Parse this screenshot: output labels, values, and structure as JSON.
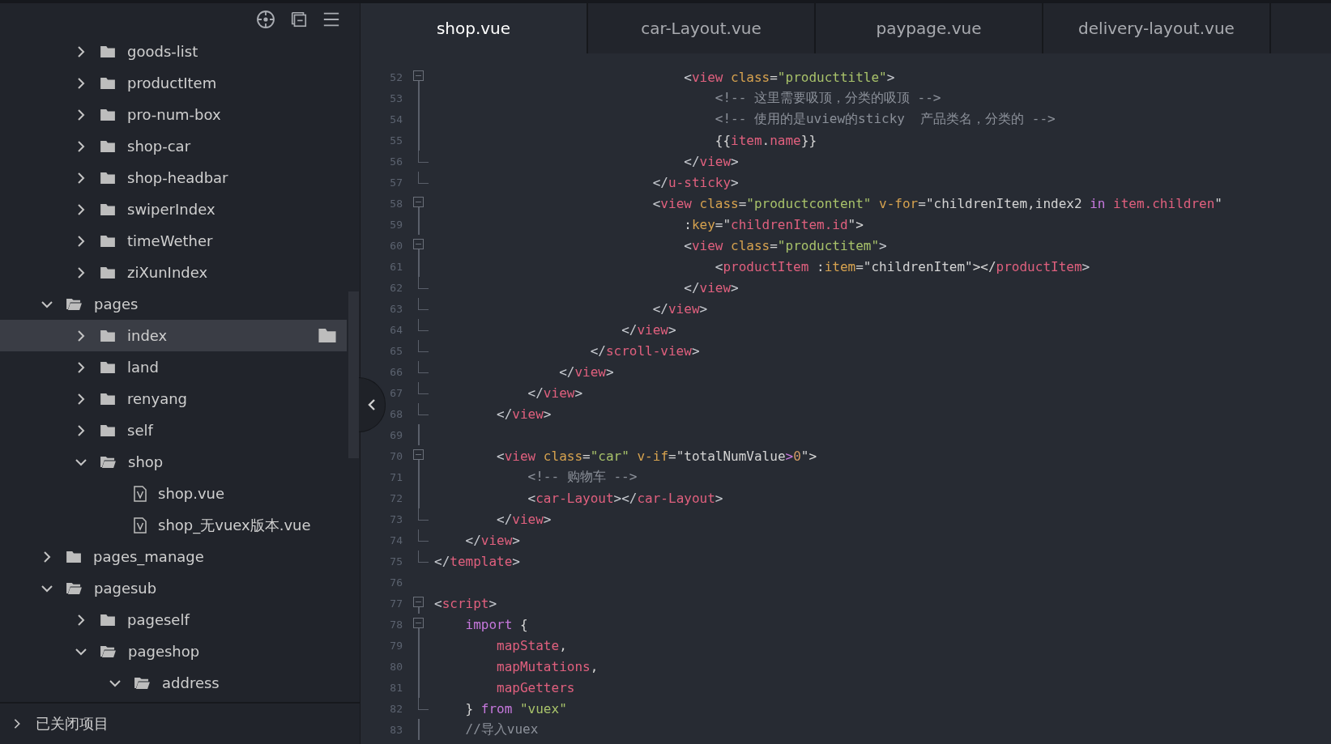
{
  "sidebar": {
    "tree": [
      {
        "children": [
          {
            "label": "goods-list",
            "kind": "folder",
            "expanded": false,
            "selected": false
          },
          {
            "label": "productItem",
            "kind": "folder",
            "expanded": false,
            "selected": false
          },
          {
            "label": "pro-num-box",
            "kind": "folder",
            "expanded": false,
            "selected": false
          },
          {
            "label": "shop-car",
            "kind": "folder",
            "expanded": false,
            "selected": false
          },
          {
            "label": "shop-headbar",
            "kind": "folder",
            "expanded": false,
            "selected": false
          },
          {
            "label": "swiperIndex",
            "kind": "folder",
            "expanded": false,
            "selected": false
          },
          {
            "label": "timeWether",
            "kind": "folder",
            "expanded": false,
            "selected": false
          },
          {
            "label": "ziXunIndex",
            "kind": "folder",
            "expanded": false,
            "selected": false
          }
        ]
      },
      {
        "label": "pages",
        "kind": "folder",
        "expanded": true,
        "selected": false,
        "children": [
          {
            "label": "index",
            "kind": "folder",
            "expanded": false,
            "selected": true
          },
          {
            "label": "land",
            "kind": "folder",
            "expanded": false,
            "selected": false
          },
          {
            "label": "renyang",
            "kind": "folder",
            "expanded": false,
            "selected": false
          },
          {
            "label": "self",
            "kind": "folder",
            "expanded": false,
            "selected": false
          },
          {
            "label": "shop",
            "kind": "folder",
            "expanded": true,
            "selected": false,
            "children": [
              {
                "label": "shop.vue",
                "kind": "file",
                "selected": false
              },
              {
                "label": "shop_无vuex版本.vue",
                "kind": "file",
                "selected": false
              }
            ]
          }
        ]
      },
      {
        "label": "pages_manage",
        "kind": "folder",
        "expanded": false,
        "selected": false
      },
      {
        "label": "pagesub",
        "kind": "folder",
        "expanded": true,
        "selected": false,
        "children": [
          {
            "label": "pageself",
            "kind": "folder",
            "expanded": false,
            "selected": false
          },
          {
            "label": "pageshop",
            "kind": "folder",
            "expanded": true,
            "selected": false,
            "children": [
              {
                "label": "address",
                "kind": "folder",
                "expanded": true,
                "selected": false
              }
            ]
          }
        ]
      }
    ],
    "closed_projects": {
      "label": "已关闭项目",
      "expanded": false
    }
  },
  "tabs": [
    {
      "label": "shop.vue",
      "selected": true
    },
    {
      "label": "car-Layout.vue",
      "selected": false
    },
    {
      "label": "paypage.vue",
      "selected": false
    },
    {
      "label": "delivery-layout.vue",
      "selected": false
    }
  ],
  "editor": {
    "lines": [
      {
        "number": "52",
        "kind": "fold_start",
        "tokens": [
          {
            "text": "                                <",
            "kind": "p"
          },
          {
            "text": "view",
            "kind": "t"
          },
          {
            "text": " class",
            "kind": "a"
          },
          {
            "text": "=",
            "kind": "x"
          },
          {
            "text": "\"producttitle\"",
            "kind": "s"
          },
          {
            "text": ">",
            "kind": "p"
          }
        ]
      },
      {
        "number": "53",
        "kind": "fold_body",
        "tokens": [
          {
            "text": "                                    <!-- 这里需要吸顶，分类的吸顶 -->",
            "kind": "c"
          }
        ]
      },
      {
        "number": "54",
        "kind": "fold_body",
        "tokens": [
          {
            "text": "                                    <!-- 使用的是uview的sticky  产品类名，分类的 -->",
            "kind": "c"
          }
        ]
      },
      {
        "number": "55",
        "kind": "fold_body",
        "tokens": [
          {
            "text": "                                    {{",
            "kind": "x"
          },
          {
            "text": "item",
            "kind": "v"
          },
          {
            "text": ".",
            "kind": "x"
          },
          {
            "text": "name",
            "kind": "v"
          },
          {
            "text": "}}",
            "kind": "x"
          }
        ]
      },
      {
        "number": "56",
        "kind": "fold_end",
        "tokens": [
          {
            "text": "                                </",
            "kind": "p"
          },
          {
            "text": "view",
            "kind": "t"
          },
          {
            "text": ">",
            "kind": "p"
          }
        ]
      },
      {
        "number": "57",
        "kind": "fold_end",
        "tokens": [
          {
            "text": "                            </",
            "kind": "p"
          },
          {
            "text": "u-sticky",
            "kind": "t"
          },
          {
            "text": ">",
            "kind": "p"
          }
        ]
      },
      {
        "number": "58",
        "kind": "fold_start",
        "tokens": [
          {
            "text": "                            <",
            "kind": "p"
          },
          {
            "text": "view",
            "kind": "t"
          },
          {
            "text": " class",
            "kind": "a"
          },
          {
            "text": "=",
            "kind": "x"
          },
          {
            "text": "\"productcontent\"",
            "kind": "s"
          },
          {
            "text": " v-for",
            "kind": "a"
          },
          {
            "text": "=\"childrenItem,index2 ",
            "kind": "x"
          },
          {
            "text": "in",
            "kind": "k"
          },
          {
            "text": " item.children",
            "kind": "v"
          },
          {
            "text": "\"",
            "kind": "x"
          }
        ]
      },
      {
        "number": "59",
        "kind": "fold_body",
        "tokens": [
          {
            "text": "                                :",
            "kind": "x"
          },
          {
            "text": "key",
            "kind": "a"
          },
          {
            "text": "=\"",
            "kind": "x"
          },
          {
            "text": "childrenItem.id",
            "kind": "v"
          },
          {
            "text": "\">",
            "kind": "x"
          }
        ]
      },
      {
        "number": "60",
        "kind": "fold_start",
        "tokens": [
          {
            "text": "                                <",
            "kind": "p"
          },
          {
            "text": "view",
            "kind": "t"
          },
          {
            "text": " class",
            "kind": "a"
          },
          {
            "text": "=",
            "kind": "x"
          },
          {
            "text": "\"productitem\"",
            "kind": "s"
          },
          {
            "text": ">",
            "kind": "p"
          }
        ]
      },
      {
        "number": "61",
        "kind": "fold_body",
        "tokens": [
          {
            "text": "                                    <",
            "kind": "p"
          },
          {
            "text": "productItem",
            "kind": "t"
          },
          {
            "text": " :",
            "kind": "x"
          },
          {
            "text": "item",
            "kind": "a"
          },
          {
            "text": "=\"childrenItem\"></",
            "kind": "x"
          },
          {
            "text": "productItem",
            "kind": "t"
          },
          {
            "text": ">",
            "kind": "p"
          }
        ]
      },
      {
        "number": "62",
        "kind": "fold_end",
        "tokens": [
          {
            "text": "                                </",
            "kind": "p"
          },
          {
            "text": "view",
            "kind": "t"
          },
          {
            "text": ">",
            "kind": "p"
          }
        ]
      },
      {
        "number": "63",
        "kind": "fold_end",
        "tokens": [
          {
            "text": "                            </",
            "kind": "p"
          },
          {
            "text": "view",
            "kind": "t"
          },
          {
            "text": ">",
            "kind": "p"
          }
        ]
      },
      {
        "number": "64",
        "kind": "fold_end",
        "tokens": [
          {
            "text": "                        </",
            "kind": "p"
          },
          {
            "text": "view",
            "kind": "t"
          },
          {
            "text": ">",
            "kind": "p"
          }
        ]
      },
      {
        "number": "65",
        "kind": "fold_end",
        "tokens": [
          {
            "text": "                    </",
            "kind": "p"
          },
          {
            "text": "scroll-view",
            "kind": "t"
          },
          {
            "text": ">",
            "kind": "p"
          }
        ]
      },
      {
        "number": "66",
        "kind": "fold_end",
        "tokens": [
          {
            "text": "                </",
            "kind": "p"
          },
          {
            "text": "view",
            "kind": "t"
          },
          {
            "text": ">",
            "kind": "p"
          }
        ]
      },
      {
        "number": "67",
        "kind": "fold_end",
        "tokens": [
          {
            "text": "            </",
            "kind": "p"
          },
          {
            "text": "view",
            "kind": "t"
          },
          {
            "text": ">",
            "kind": "p"
          }
        ]
      },
      {
        "number": "68",
        "kind": "fold_end",
        "tokens": [
          {
            "text": "        </",
            "kind": "p"
          },
          {
            "text": "view",
            "kind": "t"
          },
          {
            "text": ">",
            "kind": "p"
          }
        ]
      },
      {
        "number": "69",
        "kind": "fold_body"
      },
      {
        "number": "70",
        "kind": "fold_start",
        "tokens": [
          {
            "text": "        <",
            "kind": "p"
          },
          {
            "text": "view",
            "kind": "t"
          },
          {
            "text": " class",
            "kind": "a"
          },
          {
            "text": "=",
            "kind": "x"
          },
          {
            "text": "\"car\"",
            "kind": "s"
          },
          {
            "text": " v-if",
            "kind": "a"
          },
          {
            "text": "=\"totalNumValue",
            "kind": "x"
          },
          {
            "text": ">",
            "kind": "k"
          },
          {
            "text": "0",
            "kind": "n"
          },
          {
            "text": "\">",
            "kind": "x"
          }
        ]
      },
      {
        "number": "71",
        "kind": "fold_body",
        "tokens": [
          {
            "text": "            <!-- 购物车 -->",
            "kind": "c"
          }
        ]
      },
      {
        "number": "72",
        "kind": "fold_body",
        "tokens": [
          {
            "text": "            <",
            "kind": "p"
          },
          {
            "text": "car-Layout",
            "kind": "t"
          },
          {
            "text": "></",
            "kind": "p"
          },
          {
            "text": "car-Layout",
            "kind": "t"
          },
          {
            "text": ">",
            "kind": "p"
          }
        ]
      },
      {
        "number": "73",
        "kind": "fold_end",
        "tokens": [
          {
            "text": "        </",
            "kind": "p"
          },
          {
            "text": "view",
            "kind": "t"
          },
          {
            "text": ">",
            "kind": "p"
          }
        ]
      },
      {
        "number": "74",
        "kind": "fold_end",
        "tokens": [
          {
            "text": "    </",
            "kind": "p"
          },
          {
            "text": "view",
            "kind": "t"
          },
          {
            "text": ">",
            "kind": "p"
          }
        ]
      },
      {
        "number": "75",
        "kind": "fold_last",
        "tokens": [
          {
            "text": "</",
            "kind": "p"
          },
          {
            "text": "template",
            "kind": "t"
          },
          {
            "text": ">",
            "kind": "p"
          }
        ]
      },
      {
        "number": "76",
        "kind": "plain"
      },
      {
        "number": "77",
        "kind": "fold_start",
        "tokens": [
          {
            "text": "<",
            "kind": "p"
          },
          {
            "text": "script",
            "kind": "t"
          },
          {
            "text": ">",
            "kind": "p"
          }
        ]
      },
      {
        "number": "78",
        "kind": "fold_start",
        "tokens": [
          {
            "text": "    import",
            "kind": "k"
          },
          {
            "text": " {",
            "kind": "x"
          }
        ]
      },
      {
        "number": "79",
        "kind": "fold_body",
        "tokens": [
          {
            "text": "        mapState",
            "kind": "v"
          },
          {
            "text": ",",
            "kind": "x"
          }
        ]
      },
      {
        "number": "80",
        "kind": "fold_body",
        "tokens": [
          {
            "text": "        mapMutations",
            "kind": "v"
          },
          {
            "text": ",",
            "kind": "x"
          }
        ]
      },
      {
        "number": "81",
        "kind": "fold_body",
        "tokens": [
          {
            "text": "        mapGetters",
            "kind": "v"
          }
        ]
      },
      {
        "number": "82",
        "kind": "fold_end",
        "tokens": [
          {
            "text": "    } ",
            "kind": "x"
          },
          {
            "text": "from",
            "kind": "k"
          },
          {
            "text": " \"vuex\"",
            "kind": "s"
          }
        ]
      },
      {
        "number": "83",
        "kind": "fold_body",
        "tokens": [
          {
            "text": "    //导入vuex",
            "kind": "c"
          }
        ]
      }
    ]
  }
}
